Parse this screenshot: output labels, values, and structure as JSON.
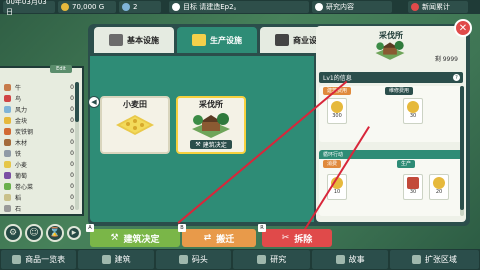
{
  "topbar": {
    "date": "00年03月03日",
    "money": "70,000 G",
    "level": "2",
    "goal": "目标 请建造Ep2。",
    "research": "研究内容",
    "right_label": "新闻累计"
  },
  "left_panel": {
    "edit_label": "Edit",
    "items": [
      {
        "name": "牛",
        "count": "0",
        "color": "#c77b4b"
      },
      {
        "name": "鸟",
        "count": "0",
        "color": "#d04545"
      },
      {
        "name": "风力",
        "count": "0",
        "color": "#7fb4d8"
      },
      {
        "name": "金块",
        "count": "0",
        "color": "#e6b93c"
      },
      {
        "name": "炭铁钢",
        "count": "0",
        "color": "#d26a33"
      },
      {
        "name": "木材",
        "count": "0",
        "color": "#a46b3b"
      },
      {
        "name": "铁",
        "count": "0",
        "color": "#8f9aa6"
      },
      {
        "name": "小麦",
        "count": "0",
        "color": "#e5c649"
      },
      {
        "name": "葡萄",
        "count": "0",
        "color": "#7b4fa3"
      },
      {
        "name": "卷心菜",
        "count": "0",
        "color": "#6ab04c"
      },
      {
        "name": "稻",
        "count": "0",
        "color": "#c9c08a"
      },
      {
        "name": "石",
        "count": "0",
        "color": "#9a9a9a"
      }
    ]
  },
  "tabs": [
    {
      "label": "基本设施",
      "active": false,
      "color": "#6b6b6b"
    },
    {
      "label": "生产设施",
      "active": true,
      "color": "#f4d04a"
    },
    {
      "label": "商业设施",
      "active": false,
      "color": "#444"
    }
  ],
  "cards": [
    {
      "title": "小麦田",
      "badge": "",
      "selected": false
    },
    {
      "title": "采伐所",
      "badge": "建筑决定",
      "selected": true
    }
  ],
  "info": {
    "title": "采伐所",
    "remain": "剩 9999",
    "level_label": "Lv1的信息",
    "help": "?",
    "cost_header_1": "建筑费用",
    "cost_header_2": "维修费用",
    "cost_1": "300",
    "cost_2": "30",
    "op_header": "循环行动",
    "consume_label": "消费",
    "produce_label": "生产",
    "consume_1": "10",
    "produce_1": "30",
    "produce_2": "20"
  },
  "actions": [
    {
      "label": "建筑决定",
      "key": "A",
      "color": "#7ab648"
    },
    {
      "label": "搬迁",
      "key": "B",
      "color": "#e89a4a"
    },
    {
      "label": "拆除",
      "key": "R",
      "color": "#e04a4a"
    }
  ],
  "bottom_nav": [
    {
      "label": "商品一览表",
      "icon": "list-icon"
    },
    {
      "label": "建筑",
      "icon": "hammer-icon"
    },
    {
      "label": "码头",
      "icon": "dock-icon"
    },
    {
      "label": "研究",
      "icon": "research-icon"
    },
    {
      "label": "故事",
      "icon": "book-icon"
    },
    {
      "label": "扩张区域",
      "icon": "expand-icon"
    }
  ]
}
